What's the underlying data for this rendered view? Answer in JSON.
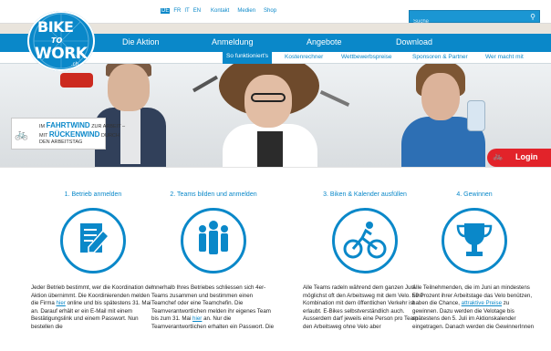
{
  "topbar": {
    "languages": [
      "DE",
      "FR",
      "IT",
      "EN"
    ],
    "active_language": "DE",
    "links": [
      "Kontakt",
      "Medien",
      "Shop"
    ],
    "search_placeholder": "Suche"
  },
  "logo": {
    "line1": "BIKE",
    "line2": "TO",
    "line3": "WORK",
    "suffix": ".ch"
  },
  "nav": {
    "items": [
      "Die Aktion",
      "Anmeldung",
      "Angebote",
      "Download"
    ],
    "subitems": [
      "So funktioniert's",
      "Kostenrechner",
      "Wettbewerbspreise",
      "Sponsoren & Partner",
      "Wer macht mit"
    ],
    "active_sub": "So funktioniert's"
  },
  "hero": {
    "slogan_1a": "IM",
    "slogan_1b": "FAHRTWIND",
    "slogan_1c": "ZUR ARBEIT –",
    "slogan_2a": "MIT",
    "slogan_2b": "RÜCKENWIND",
    "slogan_2c": "DURCH",
    "slogan_3": "DEN ARBEITSTAG",
    "login_label": "Login"
  },
  "steps": [
    {
      "title": "1. Betrieb anmelden",
      "icon": "document-pen-icon",
      "text_before": "Jeder Betrieb bestimmt, wer die Koordination der Aktion übernimmt. Die Koordinierenden melden die Firma ",
      "link": "hier",
      "text_after": " online und bis spätestens 31. Mai an. Darauf erhält er ein E-Mail mit einem Bestätigungslink und einem Passwort. Nun bestellen die"
    },
    {
      "title": "2. Teams bilden und anmelden",
      "icon": "team-icon",
      "text_before": "Innerhalb Ihres Betriebes schliessen sich 4er-Teams zusammen und bestimmen einen Teamchef oder eine Teamchefin. Die Teamverantwortlichen melden ihr eigenes Team bis zum 31. Mai ",
      "link": "hier",
      "text_after": " an. Nur die Teamverantwortlichen erhalten ein Passwort. Die"
    },
    {
      "title": "3. Biken & Kalender ausfüllen",
      "icon": "cyclist-icon",
      "text_before": "Alle Teams radeln während dem ganzen Juni möglichst oft den Arbeitsweg mit dem Velo. Eine Kombination mit dem öffentlichen Verkehr ist erlaubt. E-Bikes selbstverständlich auch. Ausserdem darf jeweils eine Person pro Team den Arbeitsweg ohne Velo aber",
      "link": "",
      "text_after": ""
    },
    {
      "title": "4. Gewinnen",
      "icon": "trophy-icon",
      "text_before": "Alle Teilnehmenden, die im Juni an mindestens 50 Prozent ihrer Arbeitstage das Velo benützen, haben die Chance, ",
      "link": "attraktive Preise",
      "text_after": " zu gewinnen. Dazu werden die Velotage bis spätestens den 5. Juli im Aktionskalender eingetragen. Danach werden die GewinnerInnen"
    }
  ],
  "colors": {
    "brand_blue": "#0a88c9",
    "login_red": "#e2232a"
  }
}
